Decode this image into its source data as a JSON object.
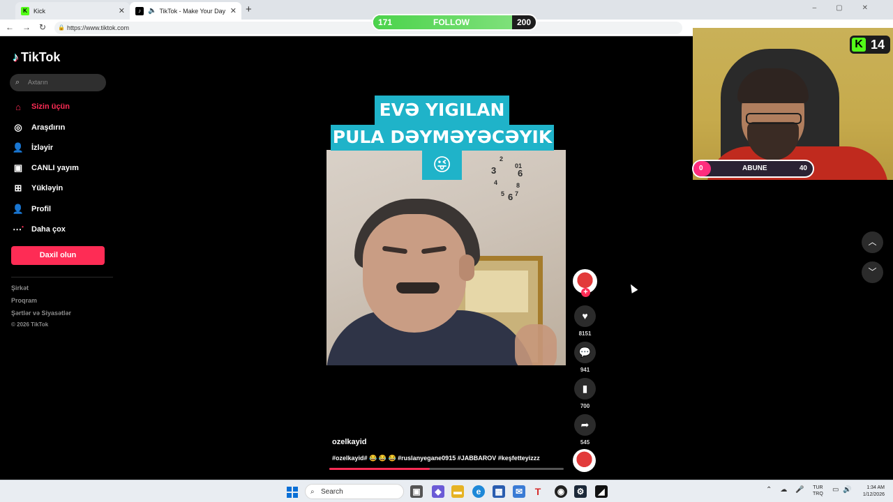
{
  "browser": {
    "tabs": [
      {
        "title": "Kick",
        "icon": "kick-icon"
      },
      {
        "title": "TikTok - Make Your Day",
        "icon": "tiktok-icon"
      }
    ],
    "url": "https://www.tiktok.com"
  },
  "follow_goal": {
    "current": "171",
    "label": "FOLLOW",
    "target": "200",
    "progress": 0.855
  },
  "sidebar": {
    "brand": "TikTok",
    "search_placeholder": "Axtarın",
    "nav": [
      {
        "label": "Sizin üçün",
        "icon": "home-icon",
        "active": true
      },
      {
        "label": "Araşdırın",
        "icon": "compass-icon"
      },
      {
        "label": "İzləyir",
        "icon": "following-icon"
      },
      {
        "label": "CANLI yayım",
        "icon": "live-icon"
      },
      {
        "label": "Yükləyin",
        "icon": "upload-icon"
      },
      {
        "label": "Profil",
        "icon": "profile-icon"
      },
      {
        "label": "Daha çox",
        "icon": "more-icon"
      }
    ],
    "login_label": "Daxil olun",
    "footer_links": [
      "Şirkət",
      "Proqram",
      "Şərtlər və Siyasətlər"
    ],
    "copyright": "© 2026 TikTok"
  },
  "video": {
    "caption_lines": [
      "EVƏ YIGILAN",
      "PULA DƏYMƏYƏCƏYIK",
      "😜"
    ],
    "author": "ozelkayid",
    "description": "#ozelkayid# 😂 😂 😂 #ruslanyegane0915 #JABBAROV #keşfetteyizzz",
    "progress": 0.43,
    "actions": {
      "likes": "8151",
      "comments": "941",
      "saves": "700",
      "shares": "545"
    }
  },
  "stream_overlay": {
    "kick_count": "14",
    "sub_goal": {
      "current": "0",
      "label": "ABUNE",
      "target": "40"
    }
  },
  "taskbar": {
    "search_label": "Search",
    "lang_line1": "TUR",
    "lang_line2": "TRQ",
    "time": "1:34 AM",
    "date": "1/12/2026"
  }
}
